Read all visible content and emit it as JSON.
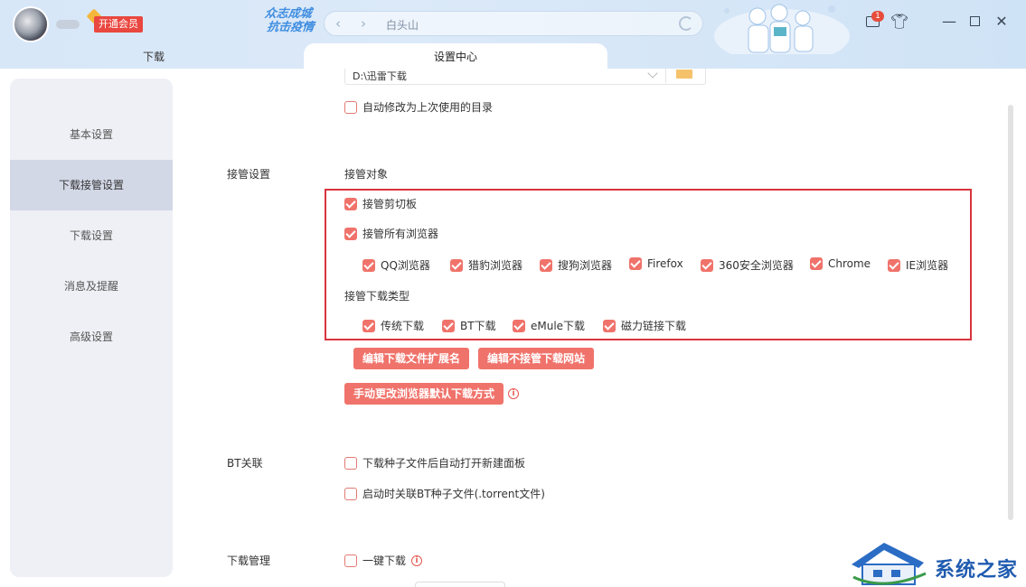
{
  "titlebar": {
    "vip_label": "开通会员",
    "slogan_line1": "众志成城",
    "slogan_line2": "抗击疫情",
    "search_text": "白头山",
    "msg_badge": "1"
  },
  "tabs": [
    {
      "label": "下载"
    },
    {
      "label": "设置中心"
    }
  ],
  "sidebar": {
    "items": [
      {
        "label": "基本设置"
      },
      {
        "label": "下载接管设置",
        "active": true
      },
      {
        "label": "下载设置"
      },
      {
        "label": "消息及提醒"
      },
      {
        "label": "高级设置"
      }
    ]
  },
  "main": {
    "download_dir": {
      "value": "D:\\迅雷下载",
      "auto_modify_label": "自动修改为上次使用的目录",
      "auto_modify_checked": false
    },
    "takeover": {
      "section_label": "接管设置",
      "objects_label": "接管对象",
      "clipboard_label": "接管剪切板",
      "all_browsers_label": "接管所有浏览器",
      "browsers": [
        {
          "label": "QQ浏览器",
          "checked": true
        },
        {
          "label": "猎豹浏览器",
          "checked": true
        },
        {
          "label": "搜狗浏览器",
          "checked": true
        },
        {
          "label": "Firefox",
          "checked": true
        },
        {
          "label": "360安全浏览器",
          "checked": true
        },
        {
          "label": "Chrome",
          "checked": true
        },
        {
          "label": "IE浏览器",
          "checked": true
        }
      ],
      "types_label": "接管下载类型",
      "types": [
        {
          "label": "传统下载",
          "checked": true
        },
        {
          "label": "BT下载",
          "checked": true
        },
        {
          "label": "eMule下载",
          "checked": true
        },
        {
          "label": "磁力链接下载",
          "checked": true
        }
      ],
      "btn_edit_ext": "编辑下载文件扩展名",
      "btn_edit_exclude": "编辑不接管下载网站",
      "btn_manual_change": "手动更改浏览器默认下载方式",
      "info_glyph": "i"
    },
    "bt": {
      "section_label": "BT关联",
      "open_panel_label": "下载种子文件后自动打开新建面板",
      "assoc_label": "启动时关联BT种子文件(.torrent文件)"
    },
    "download_mgmt": {
      "section_label": "下载管理",
      "one_click_label": "一键下载",
      "info_glyph": "i"
    }
  },
  "watermark": {
    "text": "系统之家"
  },
  "colors": {
    "accent": "#f0736b",
    "highlight_box": "#d8343e",
    "sidebar_bg": "#eef0f5",
    "sidebar_active": "#d3d8e7"
  }
}
